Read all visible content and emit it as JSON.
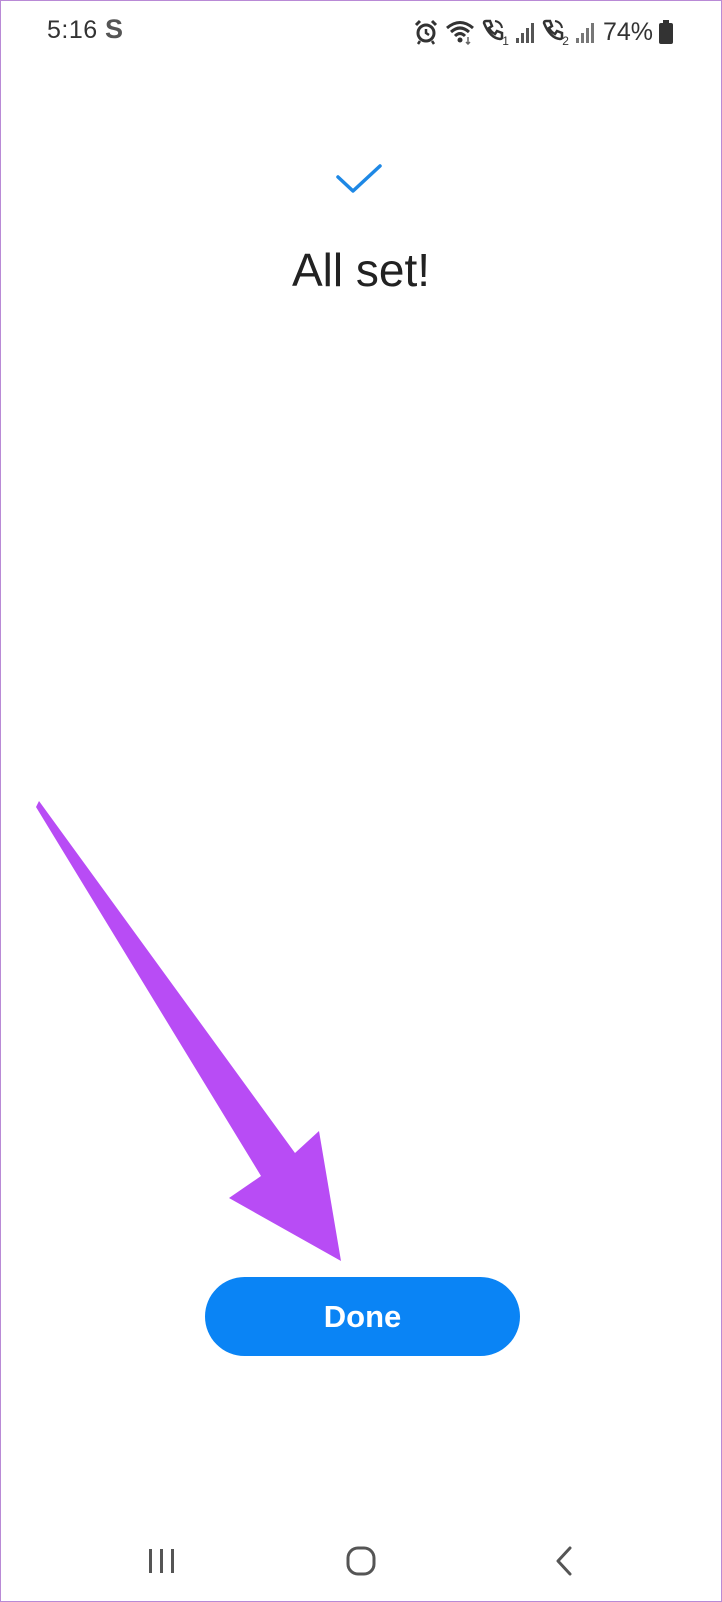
{
  "status_bar": {
    "time": "5:16",
    "s_icon_letter": "S",
    "battery_percent": "74%",
    "icons": [
      "alarm-icon",
      "wifi-icon",
      "call-sim1-icon",
      "signal-sim1-icon",
      "call-sim2-icon",
      "signal-sim2-icon",
      "battery-icon"
    ],
    "sim1_label": "1",
    "sim2_label": "2"
  },
  "main": {
    "icon": "checkmark-icon",
    "title": "All set!",
    "done_label": "Done"
  },
  "annotation": {
    "icon": "arrow-pointer-icon"
  },
  "nav_bar": {
    "icons": [
      "recent-apps-icon",
      "home-icon",
      "back-icon"
    ]
  },
  "colors": {
    "accent": "#0a84f5",
    "check": "#1e88e5",
    "arrow": "#b84cf5",
    "text": "#222222"
  }
}
